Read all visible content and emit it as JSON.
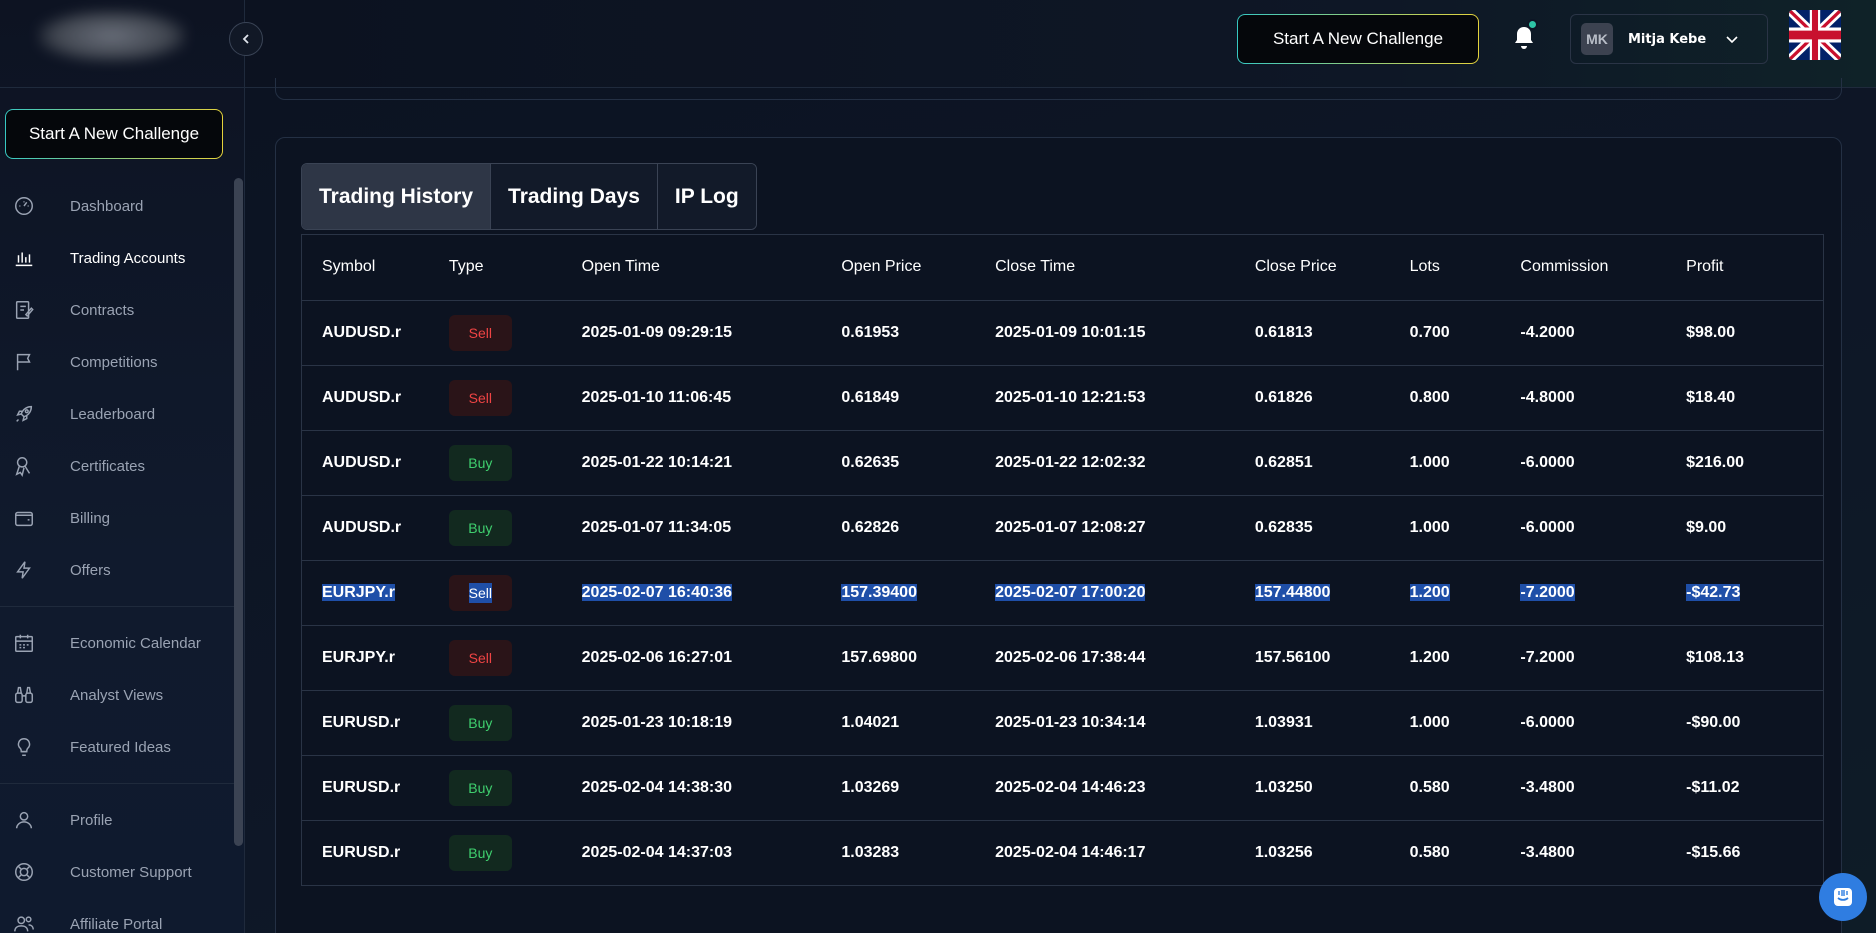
{
  "header": {
    "cta_label": "Start A New Challenge",
    "user_initials": "MK",
    "user_name": "Mitja Kebe"
  },
  "sidebar": {
    "cta_label": "Start A New Challenge",
    "items": [
      {
        "label": "Dashboard",
        "icon": "speedometer-icon"
      },
      {
        "label": "Trading Accounts",
        "icon": "chart-bars-icon",
        "active": true
      },
      {
        "label": "Contracts",
        "icon": "contract-icon"
      },
      {
        "label": "Competitions",
        "icon": "flag-icon"
      },
      {
        "label": "Leaderboard",
        "icon": "rocket-icon"
      },
      {
        "label": "Certificates",
        "icon": "ribbon-icon"
      },
      {
        "label": "Billing",
        "icon": "wallet-icon"
      },
      {
        "label": "Offers",
        "icon": "lightning-icon"
      },
      {
        "label": "Economic Calendar",
        "icon": "calendar-icon"
      },
      {
        "label": "Analyst Views",
        "icon": "binoculars-icon"
      },
      {
        "label": "Featured Ideas",
        "icon": "lightbulb-icon"
      },
      {
        "label": "Profile",
        "icon": "user-icon"
      },
      {
        "label": "Customer Support",
        "icon": "lifebuoy-icon"
      },
      {
        "label": "Affiliate Portal",
        "icon": "users-icon"
      }
    ]
  },
  "tabs": [
    "Trading History",
    "Trading Days",
    "IP Log"
  ],
  "table": {
    "columns": [
      "Symbol",
      "Type",
      "Open Time",
      "Open Price",
      "Close Time",
      "Close Price",
      "Lots",
      "Commission",
      "Profit"
    ],
    "rows": [
      [
        "AUDUSD.r",
        "Sell",
        "2025-01-09 09:29:15",
        "0.61953",
        "2025-01-09 10:01:15",
        "0.61813",
        "0.700",
        "-4.2000",
        "$98.00"
      ],
      [
        "AUDUSD.r",
        "Sell",
        "2025-01-10 11:06:45",
        "0.61849",
        "2025-01-10 12:21:53",
        "0.61826",
        "0.800",
        "-4.8000",
        "$18.40"
      ],
      [
        "AUDUSD.r",
        "Buy",
        "2025-01-22 10:14:21",
        "0.62635",
        "2025-01-22 12:02:32",
        "0.62851",
        "1.000",
        "-6.0000",
        "$216.00"
      ],
      [
        "AUDUSD.r",
        "Buy",
        "2025-01-07 11:34:05",
        "0.62826",
        "2025-01-07 12:08:27",
        "0.62835",
        "1.000",
        "-6.0000",
        "$9.00"
      ],
      [
        "EURJPY.r",
        "Sell",
        "2025-02-07 16:40:36",
        "157.39400",
        "2025-02-07 17:00:20",
        "157.44800",
        "1.200",
        "-7.2000",
        "-$42.73"
      ],
      [
        "EURJPY.r",
        "Sell",
        "2025-02-06 16:27:01",
        "157.69800",
        "2025-02-06 17:38:44",
        "157.56100",
        "1.200",
        "-7.2000",
        "$108.13"
      ],
      [
        "EURUSD.r",
        "Buy",
        "2025-01-23 10:18:19",
        "1.04021",
        "2025-01-23 10:34:14",
        "1.03931",
        "1.000",
        "-6.0000",
        "-$90.00"
      ],
      [
        "EURUSD.r",
        "Buy",
        "2025-02-04 14:38:30",
        "1.03269",
        "2025-02-04 14:46:23",
        "1.03250",
        "0.580",
        "-3.4800",
        "-$11.02"
      ],
      [
        "EURUSD.r",
        "Buy",
        "2025-02-04 14:37:03",
        "1.03283",
        "2025-02-04 14:46:17",
        "1.03256",
        "0.580",
        "-3.4800",
        "-$15.66"
      ]
    ]
  }
}
